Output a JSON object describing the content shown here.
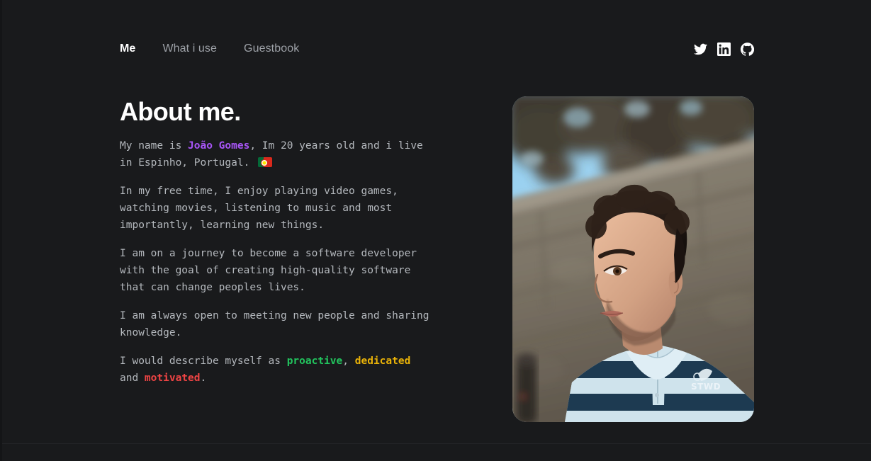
{
  "nav": {
    "items": [
      {
        "label": "Me",
        "active": true
      },
      {
        "label": "What i use",
        "active": false
      },
      {
        "label": "Guestbook",
        "active": false
      }
    ]
  },
  "socials": [
    {
      "name": "twitter-icon",
      "label": "Twitter"
    },
    {
      "name": "linkedin-icon",
      "label": "LinkedIn"
    },
    {
      "name": "github-icon",
      "label": "GitHub"
    }
  ],
  "main": {
    "title": "About me.",
    "paragraphs": {
      "p1_a": "My name is ",
      "p1_name": "João Gomes",
      "p1_b": ", Im 20 years old and i live in Espinho, Portugal. ",
      "p1_flag": "Portugal flag",
      "p2": "In my free time, I enjoy playing video games, watching movies, listening to music and most importantly, learning new things.",
      "p3": "I am on a journey to become a software developer with the goal of creating high-quality software that can change peoples lives.",
      "p4": "I am always open to meeting new people and sharing knowledge.",
      "p5_a": "I would describe myself as ",
      "p5_proactive": "proactive",
      "p5_b": ", ",
      "p5_dedicated": "dedicated",
      "p5_c": " and ",
      "p5_motivated": "motivated",
      "p5_d": "."
    }
  },
  "photo": {
    "alt": "Portrait of João Gomes in a navy and light blue striped rugby polo in front of a stone wall"
  },
  "colors": {
    "background": "#191a1c",
    "text": "#b4b8bd",
    "heading": "#ffffff",
    "nav_inactive": "#9ca0a6",
    "name_accent": "#a855f7",
    "proactive_accent": "#22c55e",
    "dedicated_accent": "#eab308",
    "motivated_accent": "#ef4444"
  }
}
